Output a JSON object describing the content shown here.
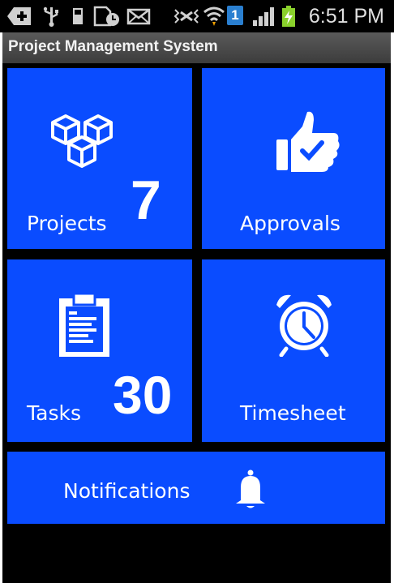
{
  "status_bar": {
    "time": "6:51 PM",
    "sim_badge": "1",
    "icons": [
      "add-icon",
      "usb-icon",
      "sd-card-icon",
      "screenshot-icon",
      "mail-icon",
      "vibrate-icon",
      "wifi-icon",
      "sim-icon",
      "signal-icon",
      "battery-charging-icon"
    ]
  },
  "app": {
    "title": "Project Management System"
  },
  "tiles": {
    "projects": {
      "label": "Projects",
      "count": "7",
      "icon": "cubes-icon"
    },
    "approvals": {
      "label": "Approvals",
      "icon": "thumbs-up-icon"
    },
    "tasks": {
      "label": "Tasks",
      "count": "30",
      "icon": "clipboard-icon"
    },
    "timesheet": {
      "label": "Timesheet",
      "icon": "alarm-clock-icon"
    },
    "notifications": {
      "label": "Notifications",
      "icon": "bell-icon"
    }
  },
  "colors": {
    "tile_blue": "#0a4cff",
    "background": "#000000",
    "title_bar": "#4a4a4a"
  }
}
